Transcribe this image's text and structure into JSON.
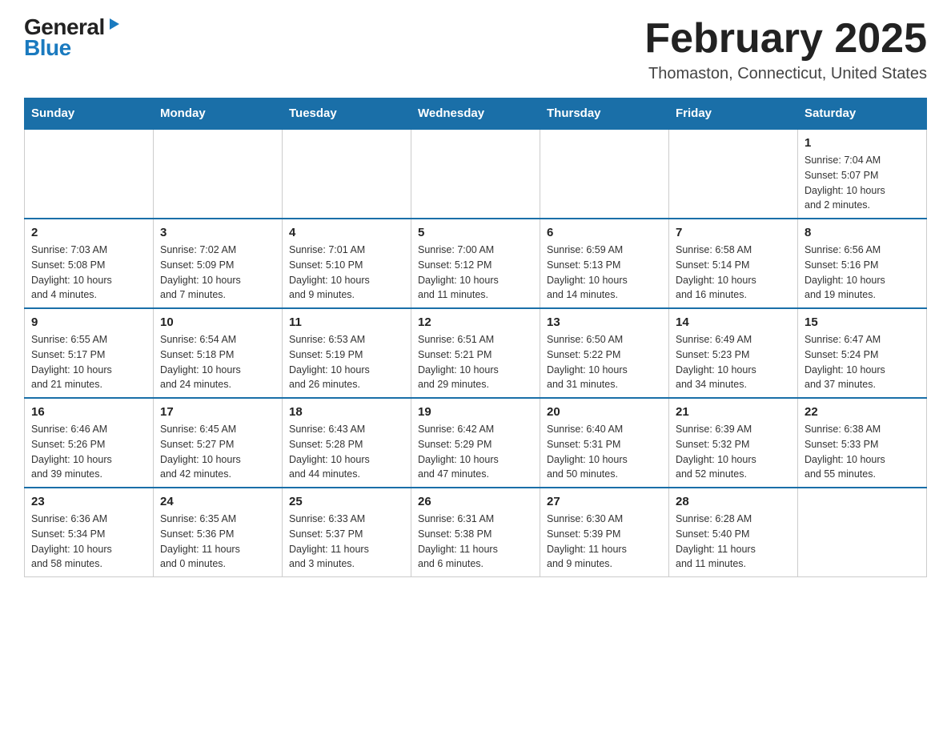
{
  "header": {
    "logo_general": "General",
    "logo_blue": "Blue",
    "title": "February 2025",
    "subtitle": "Thomaston, Connecticut, United States"
  },
  "days_of_week": [
    "Sunday",
    "Monday",
    "Tuesday",
    "Wednesday",
    "Thursday",
    "Friday",
    "Saturday"
  ],
  "weeks": [
    [
      {
        "day": "",
        "info": ""
      },
      {
        "day": "",
        "info": ""
      },
      {
        "day": "",
        "info": ""
      },
      {
        "day": "",
        "info": ""
      },
      {
        "day": "",
        "info": ""
      },
      {
        "day": "",
        "info": ""
      },
      {
        "day": "1",
        "info": "Sunrise: 7:04 AM\nSunset: 5:07 PM\nDaylight: 10 hours\nand 2 minutes."
      }
    ],
    [
      {
        "day": "2",
        "info": "Sunrise: 7:03 AM\nSunset: 5:08 PM\nDaylight: 10 hours\nand 4 minutes."
      },
      {
        "day": "3",
        "info": "Sunrise: 7:02 AM\nSunset: 5:09 PM\nDaylight: 10 hours\nand 7 minutes."
      },
      {
        "day": "4",
        "info": "Sunrise: 7:01 AM\nSunset: 5:10 PM\nDaylight: 10 hours\nand 9 minutes."
      },
      {
        "day": "5",
        "info": "Sunrise: 7:00 AM\nSunset: 5:12 PM\nDaylight: 10 hours\nand 11 minutes."
      },
      {
        "day": "6",
        "info": "Sunrise: 6:59 AM\nSunset: 5:13 PM\nDaylight: 10 hours\nand 14 minutes."
      },
      {
        "day": "7",
        "info": "Sunrise: 6:58 AM\nSunset: 5:14 PM\nDaylight: 10 hours\nand 16 minutes."
      },
      {
        "day": "8",
        "info": "Sunrise: 6:56 AM\nSunset: 5:16 PM\nDaylight: 10 hours\nand 19 minutes."
      }
    ],
    [
      {
        "day": "9",
        "info": "Sunrise: 6:55 AM\nSunset: 5:17 PM\nDaylight: 10 hours\nand 21 minutes."
      },
      {
        "day": "10",
        "info": "Sunrise: 6:54 AM\nSunset: 5:18 PM\nDaylight: 10 hours\nand 24 minutes."
      },
      {
        "day": "11",
        "info": "Sunrise: 6:53 AM\nSunset: 5:19 PM\nDaylight: 10 hours\nand 26 minutes."
      },
      {
        "day": "12",
        "info": "Sunrise: 6:51 AM\nSunset: 5:21 PM\nDaylight: 10 hours\nand 29 minutes."
      },
      {
        "day": "13",
        "info": "Sunrise: 6:50 AM\nSunset: 5:22 PM\nDaylight: 10 hours\nand 31 minutes."
      },
      {
        "day": "14",
        "info": "Sunrise: 6:49 AM\nSunset: 5:23 PM\nDaylight: 10 hours\nand 34 minutes."
      },
      {
        "day": "15",
        "info": "Sunrise: 6:47 AM\nSunset: 5:24 PM\nDaylight: 10 hours\nand 37 minutes."
      }
    ],
    [
      {
        "day": "16",
        "info": "Sunrise: 6:46 AM\nSunset: 5:26 PM\nDaylight: 10 hours\nand 39 minutes."
      },
      {
        "day": "17",
        "info": "Sunrise: 6:45 AM\nSunset: 5:27 PM\nDaylight: 10 hours\nand 42 minutes."
      },
      {
        "day": "18",
        "info": "Sunrise: 6:43 AM\nSunset: 5:28 PM\nDaylight: 10 hours\nand 44 minutes."
      },
      {
        "day": "19",
        "info": "Sunrise: 6:42 AM\nSunset: 5:29 PM\nDaylight: 10 hours\nand 47 minutes."
      },
      {
        "day": "20",
        "info": "Sunrise: 6:40 AM\nSunset: 5:31 PM\nDaylight: 10 hours\nand 50 minutes."
      },
      {
        "day": "21",
        "info": "Sunrise: 6:39 AM\nSunset: 5:32 PM\nDaylight: 10 hours\nand 52 minutes."
      },
      {
        "day": "22",
        "info": "Sunrise: 6:38 AM\nSunset: 5:33 PM\nDaylight: 10 hours\nand 55 minutes."
      }
    ],
    [
      {
        "day": "23",
        "info": "Sunrise: 6:36 AM\nSunset: 5:34 PM\nDaylight: 10 hours\nand 58 minutes."
      },
      {
        "day": "24",
        "info": "Sunrise: 6:35 AM\nSunset: 5:36 PM\nDaylight: 11 hours\nand 0 minutes."
      },
      {
        "day": "25",
        "info": "Sunrise: 6:33 AM\nSunset: 5:37 PM\nDaylight: 11 hours\nand 3 minutes."
      },
      {
        "day": "26",
        "info": "Sunrise: 6:31 AM\nSunset: 5:38 PM\nDaylight: 11 hours\nand 6 minutes."
      },
      {
        "day": "27",
        "info": "Sunrise: 6:30 AM\nSunset: 5:39 PM\nDaylight: 11 hours\nand 9 minutes."
      },
      {
        "day": "28",
        "info": "Sunrise: 6:28 AM\nSunset: 5:40 PM\nDaylight: 11 hours\nand 11 minutes."
      },
      {
        "day": "",
        "info": ""
      }
    ]
  ]
}
